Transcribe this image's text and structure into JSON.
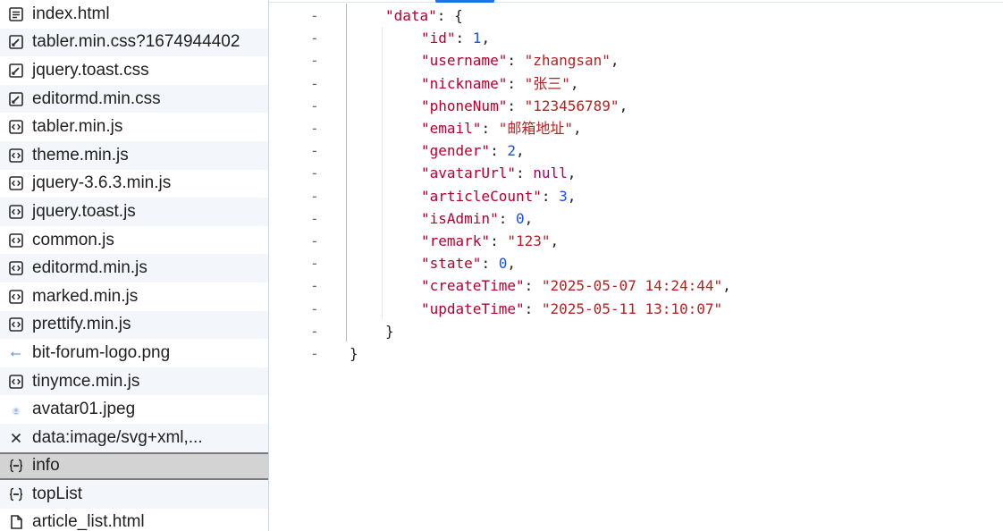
{
  "sidebar": {
    "items": [
      {
        "icon": "document-icon",
        "label": "index.html"
      },
      {
        "icon": "stylesheet-icon",
        "label": "tabler.min.css?1674944402"
      },
      {
        "icon": "stylesheet-icon",
        "label": "jquery.toast.css"
      },
      {
        "icon": "stylesheet-icon",
        "label": "editormd.min.css"
      },
      {
        "icon": "script-icon",
        "label": "tabler.min.js"
      },
      {
        "icon": "script-icon",
        "label": "theme.min.js"
      },
      {
        "icon": "script-icon",
        "label": "jquery-3.6.3.min.js"
      },
      {
        "icon": "script-icon",
        "label": "jquery.toast.js"
      },
      {
        "icon": "script-icon",
        "label": "common.js"
      },
      {
        "icon": "script-icon",
        "label": "editormd.min.js"
      },
      {
        "icon": "script-icon",
        "label": "marked.min.js"
      },
      {
        "icon": "script-icon",
        "label": "prettify.min.js"
      },
      {
        "icon": "image-icon",
        "label": "bit-forum-logo.png"
      },
      {
        "icon": "script-icon",
        "label": "tinymce.min.js"
      },
      {
        "icon": "avatar-image-icon",
        "label": "avatar01.jpeg"
      },
      {
        "icon": "error-icon",
        "label": "data:image/svg+xml,..."
      },
      {
        "icon": "json-icon",
        "label": "info"
      },
      {
        "icon": "json-icon",
        "label": "topList"
      },
      {
        "icon": "file-icon",
        "label": "article_list.html"
      }
    ],
    "selected_index": 16
  },
  "json_view": {
    "fold_marker": "-",
    "lines": [
      {
        "fold": "-",
        "tokens": [
          {
            "t": "k",
            "v": "\"data\""
          },
          {
            "t": "p",
            "v": ": {"
          }
        ]
      },
      {
        "fold": "-",
        "tokens": [
          {
            "t": "k",
            "v": "\"id\""
          },
          {
            "t": "p",
            "v": ": "
          },
          {
            "t": "n",
            "v": "1"
          },
          {
            "t": "p",
            "v": ","
          }
        ]
      },
      {
        "fold": "-",
        "tokens": [
          {
            "t": "k",
            "v": "\"username\""
          },
          {
            "t": "p",
            "v": ": "
          },
          {
            "t": "s",
            "v": "\"zhangsan\""
          },
          {
            "t": "p",
            "v": ","
          }
        ]
      },
      {
        "fold": "-",
        "tokens": [
          {
            "t": "k",
            "v": "\"nickname\""
          },
          {
            "t": "p",
            "v": ": "
          },
          {
            "t": "s",
            "v": "\"张三\""
          },
          {
            "t": "p",
            "v": ","
          }
        ]
      },
      {
        "fold": "-",
        "tokens": [
          {
            "t": "k",
            "v": "\"phoneNum\""
          },
          {
            "t": "p",
            "v": ": "
          },
          {
            "t": "s",
            "v": "\"123456789\""
          },
          {
            "t": "p",
            "v": ","
          }
        ]
      },
      {
        "fold": "-",
        "tokens": [
          {
            "t": "k",
            "v": "\"email\""
          },
          {
            "t": "p",
            "v": ": "
          },
          {
            "t": "s",
            "v": "\"邮箱地址\""
          },
          {
            "t": "p",
            "v": ","
          }
        ]
      },
      {
        "fold": "-",
        "tokens": [
          {
            "t": "k",
            "v": "\"gender\""
          },
          {
            "t": "p",
            "v": ": "
          },
          {
            "t": "n",
            "v": "2"
          },
          {
            "t": "p",
            "v": ","
          }
        ]
      },
      {
        "fold": "-",
        "tokens": [
          {
            "t": "k",
            "v": "\"avatarUrl\""
          },
          {
            "t": "p",
            "v": ": "
          },
          {
            "t": "nl",
            "v": "null"
          },
          {
            "t": "p",
            "v": ","
          }
        ]
      },
      {
        "fold": "-",
        "tokens": [
          {
            "t": "k",
            "v": "\"articleCount\""
          },
          {
            "t": "p",
            "v": ": "
          },
          {
            "t": "n",
            "v": "3"
          },
          {
            "t": "p",
            "v": ","
          }
        ]
      },
      {
        "fold": "-",
        "tokens": [
          {
            "t": "k",
            "v": "\"isAdmin\""
          },
          {
            "t": "p",
            "v": ": "
          },
          {
            "t": "n",
            "v": "0"
          },
          {
            "t": "p",
            "v": ","
          }
        ]
      },
      {
        "fold": "-",
        "tokens": [
          {
            "t": "k",
            "v": "\"remark\""
          },
          {
            "t": "p",
            "v": ": "
          },
          {
            "t": "s",
            "v": "\"123\""
          },
          {
            "t": "p",
            "v": ","
          }
        ]
      },
      {
        "fold": "-",
        "tokens": [
          {
            "t": "k",
            "v": "\"state\""
          },
          {
            "t": "p",
            "v": ": "
          },
          {
            "t": "n",
            "v": "0"
          },
          {
            "t": "p",
            "v": ","
          }
        ]
      },
      {
        "fold": "-",
        "tokens": [
          {
            "t": "k",
            "v": "\"createTime\""
          },
          {
            "t": "p",
            "v": ": "
          },
          {
            "t": "s",
            "v": "\"2025-05-07 14:24:44\""
          },
          {
            "t": "p",
            "v": ","
          }
        ]
      },
      {
        "fold": "-",
        "tokens": [
          {
            "t": "k",
            "v": "\"updateTime\""
          },
          {
            "t": "p",
            "v": ": "
          },
          {
            "t": "s",
            "v": "\"2025-05-11 13:10:07\""
          }
        ]
      },
      {
        "fold": "-",
        "tokens": [
          {
            "t": "p",
            "v": "}"
          }
        ]
      },
      {
        "fold": "-",
        "tokens": [
          {
            "t": "p",
            "v": "}"
          }
        ]
      }
    ]
  },
  "colors": {
    "key": "#b5002f",
    "string": "#b22222",
    "number": "#1750eb",
    "null": "#a0006e",
    "accent": "#1a73e8",
    "selected_row": "#d3d3d3"
  }
}
